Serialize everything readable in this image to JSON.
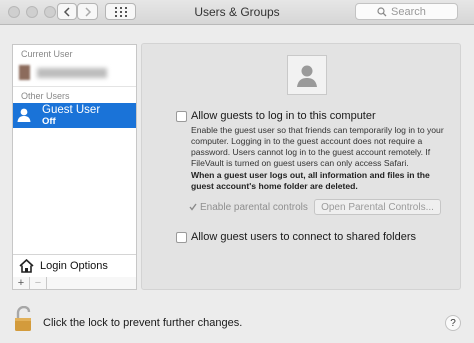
{
  "window": {
    "title": "Users & Groups"
  },
  "toolbar": {
    "search_placeholder": "Search"
  },
  "sidebar": {
    "current_user_label": "Current User",
    "other_users_label": "Other Users",
    "guest_user": {
      "name": "Guest User",
      "status": "Off"
    },
    "login_options_label": "Login Options",
    "add_label": "+",
    "remove_label": "−"
  },
  "panel": {
    "allow_login_label": "Allow guests to log in to this computer",
    "description": "Enable the guest user so that friends can temporarily log in to your computer. Logging in to the guest account does not require a password. Users cannot log in to the guest account remotely. If FileVault is turned on guest users can only access Safari.",
    "warning": "When a guest user logs out, all information and files in the guest account's home folder are deleted.",
    "parental_controls_label": "Enable parental controls",
    "open_parental_controls_button": "Open Parental Controls...",
    "shared_folders_label": "Allow guest users to connect to shared folders"
  },
  "footer": {
    "lock_text": "Click the lock to prevent further changes.",
    "help_label": "?"
  },
  "colors": {
    "selection": "#1a73d8",
    "window_bg": "#ececec",
    "panel_bg": "#e3e3e3"
  }
}
